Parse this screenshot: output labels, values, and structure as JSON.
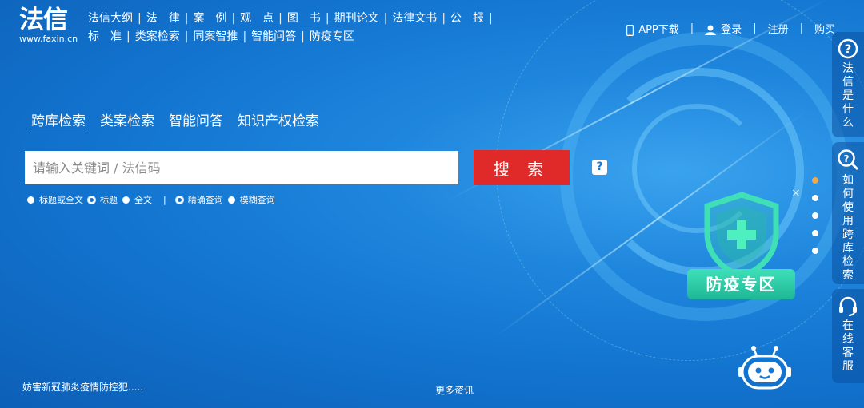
{
  "logo": {
    "mark": "法信",
    "url": "www.faxin.cn"
  },
  "nav": {
    "row1": [
      "法信大纲",
      "法　律",
      "案　例",
      "观　点",
      "图　书",
      "期刊论文",
      "法律文书",
      "公　报"
    ],
    "row2": [
      "标　准",
      "类案检索",
      "同案智推",
      "智能问答",
      "防疫专区"
    ]
  },
  "user_links": {
    "app": "APP下载",
    "login": "登录",
    "register": "注册",
    "buy": "购买"
  },
  "search": {
    "tabs": [
      "跨库检索",
      "类案检索",
      "智能问答",
      "知识产权检索"
    ],
    "active_tab": "跨库检索",
    "placeholder": "请输入关键词 / 法信码",
    "button": "搜 索",
    "help": "?",
    "options": {
      "scope": [
        "标题或全文",
        "标题",
        "全文"
      ],
      "scope_selected": "标题",
      "match": [
        "精确查询",
        "模糊查询"
      ],
      "match_selected": "精确查询"
    }
  },
  "ticker": "妨害新冠肺炎疫情防控犯.....",
  "more_news": "更多资讯",
  "epidemic": {
    "label": "防疫专区",
    "close": "×"
  },
  "carousel": {
    "count": 5,
    "active_index": 0
  },
  "sidebar": [
    {
      "icon": "question-circle-icon",
      "label": "法信是什么"
    },
    {
      "icon": "search-question-icon",
      "label": "如何使用跨库检索"
    },
    {
      "icon": "headset-icon",
      "label": "在线客服"
    }
  ],
  "colors": {
    "search_button": "#e02a2a",
    "badge": "#2ccaa6",
    "background": "#1478d2",
    "active_dot": "#f0a64a"
  }
}
